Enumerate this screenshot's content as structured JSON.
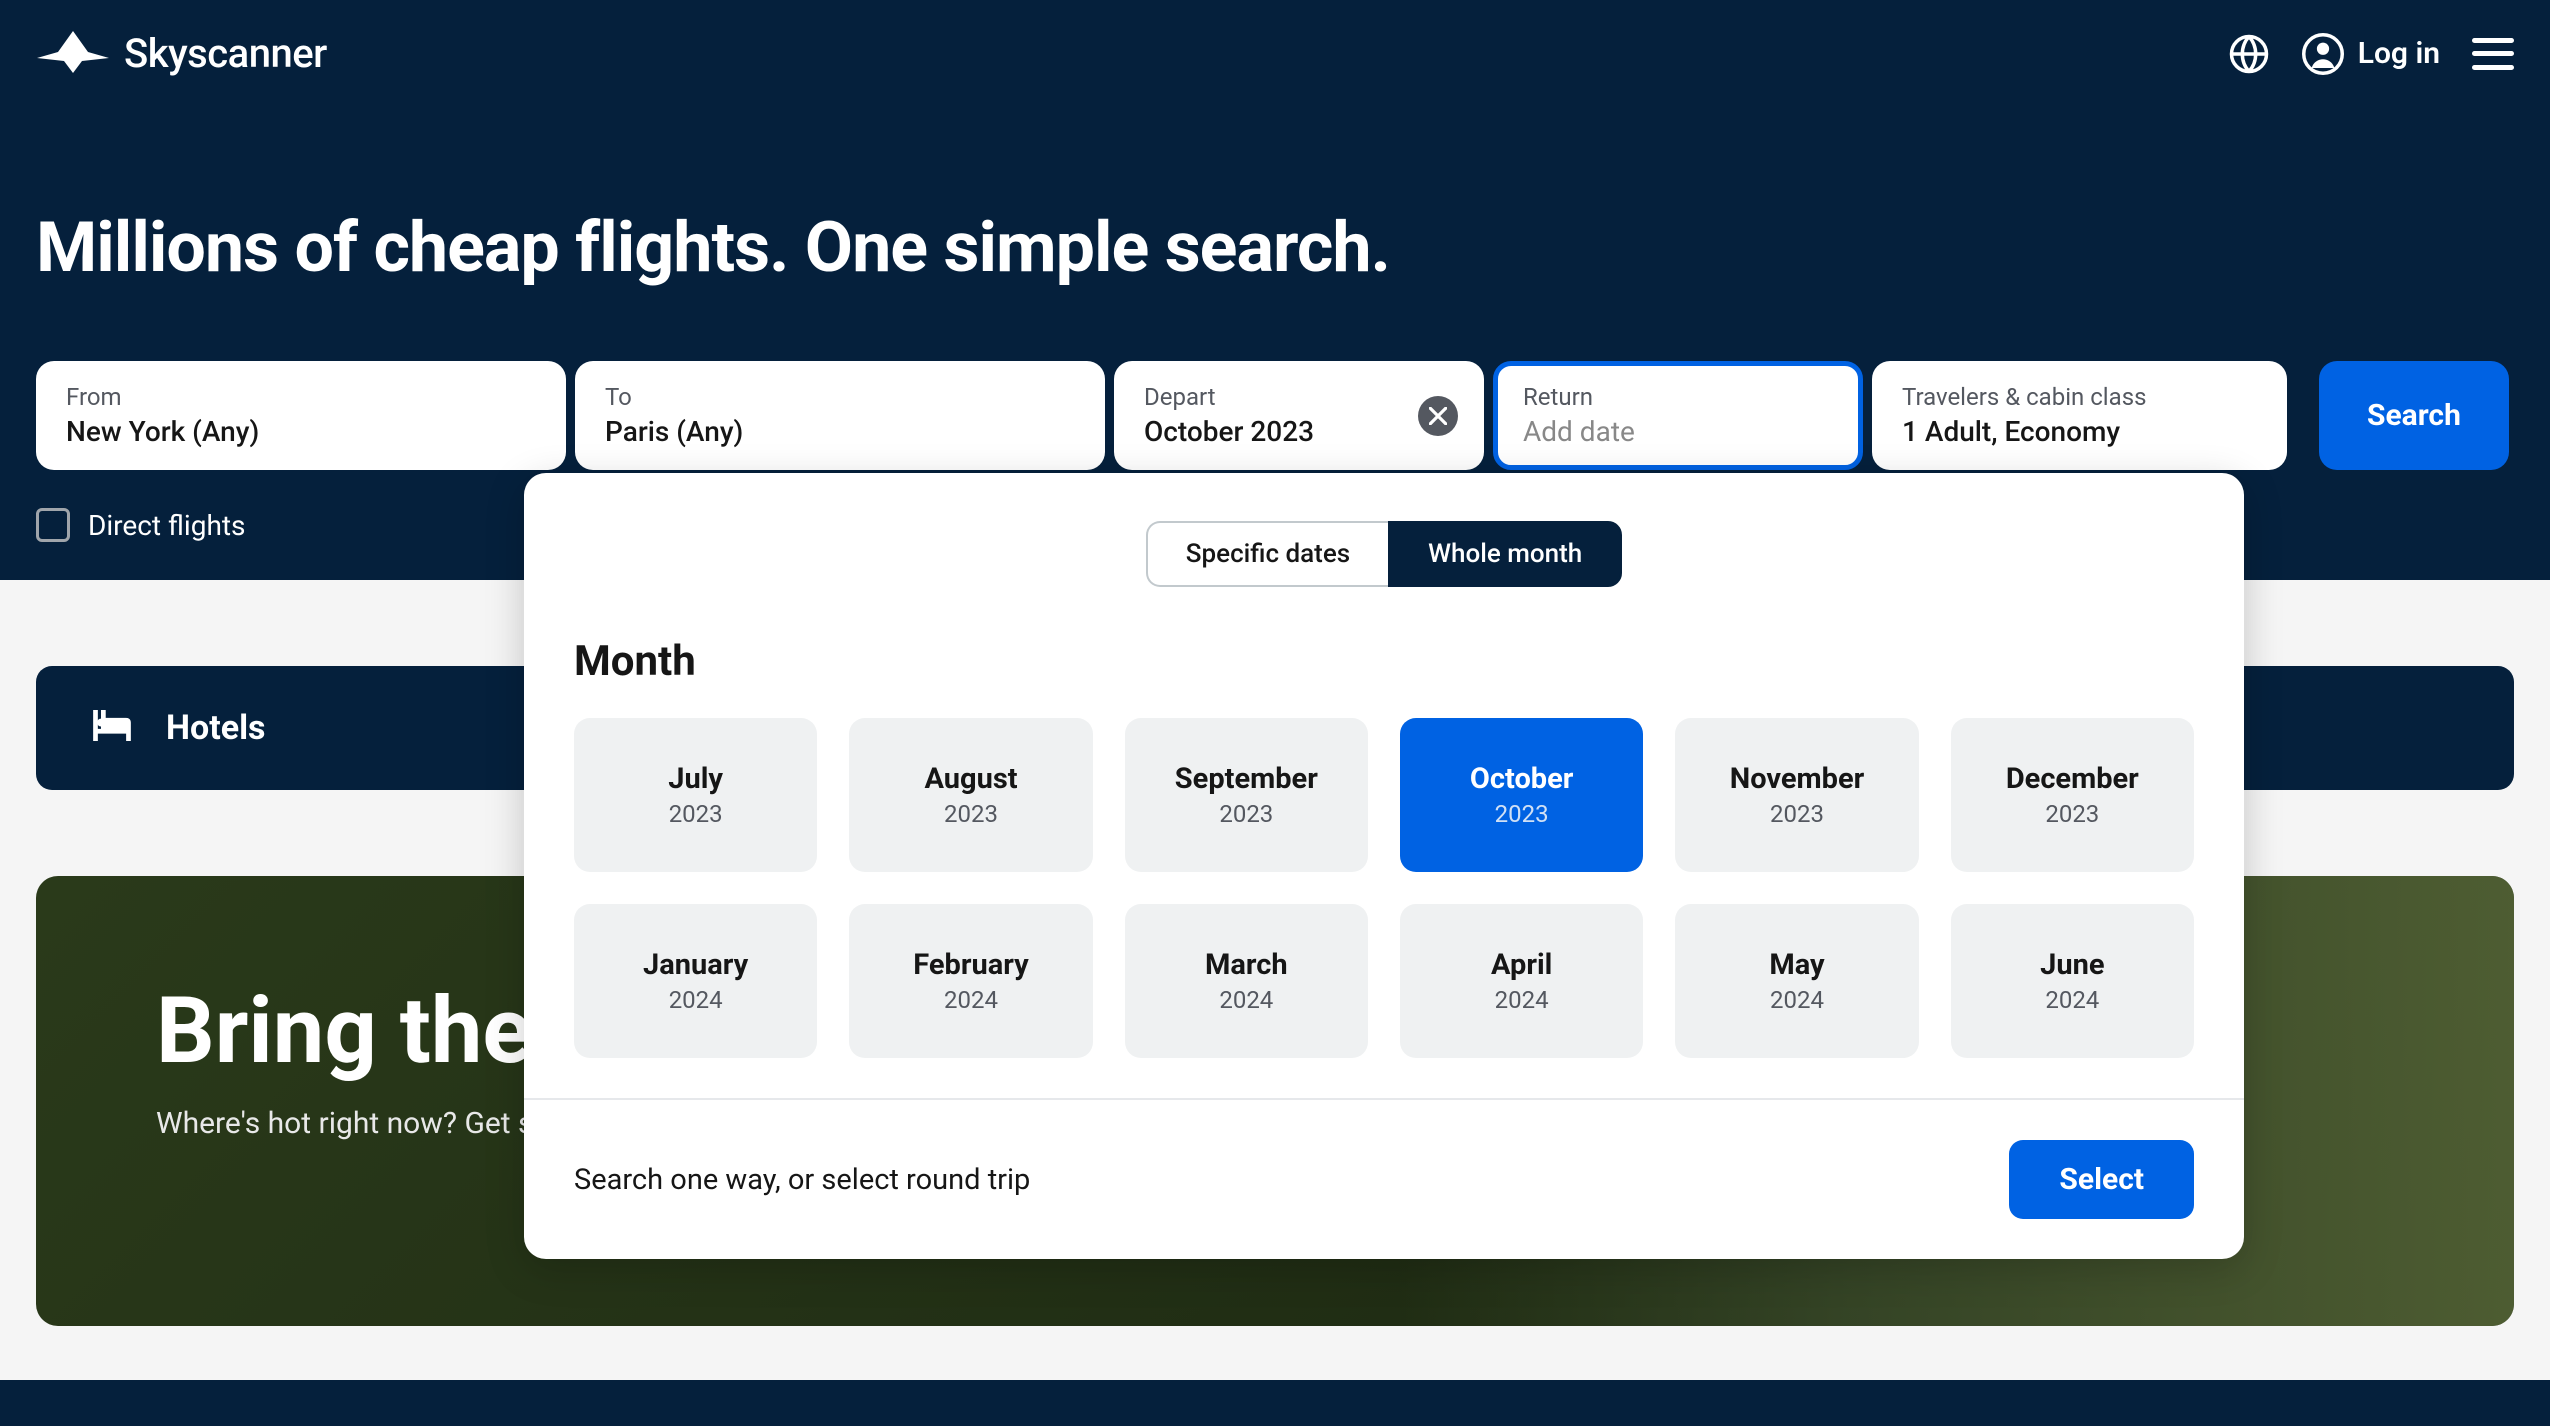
{
  "brand": "Skyscanner",
  "header": {
    "login_label": "Log in"
  },
  "hero": {
    "title": "Millions of cheap flights. One simple search."
  },
  "search": {
    "from_label": "From",
    "from_value": "New York (Any)",
    "to_label": "To",
    "to_value": "Paris (Any)",
    "depart_label": "Depart",
    "depart_value": "October 2023",
    "return_label": "Return",
    "return_placeholder": "Add date",
    "travelers_label": "Travelers & cabin class",
    "travelers_value": "1 Adult, Economy",
    "search_button": "Search",
    "direct_flights_label": "Direct flights"
  },
  "popup": {
    "tab_specific": "Specific dates",
    "tab_whole": "Whole month",
    "section_title": "Month",
    "months": [
      {
        "name": "July",
        "year": "2023",
        "selected": false
      },
      {
        "name": "August",
        "year": "2023",
        "selected": false
      },
      {
        "name": "September",
        "year": "2023",
        "selected": false
      },
      {
        "name": "October",
        "year": "2023",
        "selected": true
      },
      {
        "name": "November",
        "year": "2023",
        "selected": false
      },
      {
        "name": "December",
        "year": "2023",
        "selected": false
      },
      {
        "name": "January",
        "year": "2024",
        "selected": false
      },
      {
        "name": "February",
        "year": "2024",
        "selected": false
      },
      {
        "name": "March",
        "year": "2024",
        "selected": false
      },
      {
        "name": "April",
        "year": "2024",
        "selected": false
      },
      {
        "name": "May",
        "year": "2024",
        "selected": false
      },
      {
        "name": "June",
        "year": "2024",
        "selected": false
      }
    ],
    "footer_text": "Search one way, or select round trip",
    "select_button": "Select"
  },
  "hotels": {
    "label": "Hotels"
  },
  "promo": {
    "title": "Bring the",
    "subtitle": "Where's hot right now? Get some sun on your skin"
  }
}
